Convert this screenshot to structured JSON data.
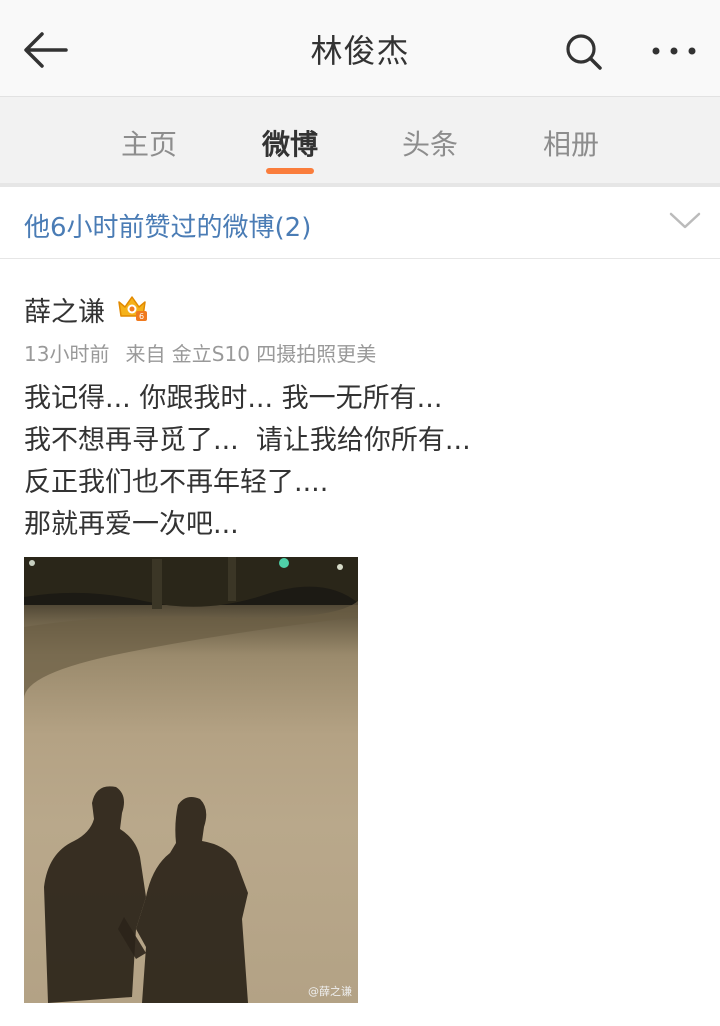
{
  "topbar": {
    "title": "林俊杰",
    "back_icon": "arrow-left-icon",
    "search_icon": "search-icon",
    "more_icon": "more-dots-icon"
  },
  "tabs": [
    {
      "label": "主页",
      "active": false
    },
    {
      "label": "微博",
      "active": true
    },
    {
      "label": "头条",
      "active": false
    },
    {
      "label": "相册",
      "active": false
    }
  ],
  "liked_section": {
    "label": "他6小时前赞过的微博(2)",
    "chevron_icon": "chevron-down-icon"
  },
  "post": {
    "author": "薛之谦",
    "badge_icon": "crown-vip-badge-icon",
    "time": "13小时前",
    "source": "来自 金立S10 四摄拍照更美",
    "lines": [
      "我记得... 你跟我时... 我一无所有...",
      "我不想再寻觅了...  请让我给你所有...",
      "反正我们也不再年轻了....",
      "那就再爱一次吧..."
    ],
    "image_watermark": "@薛之谦"
  },
  "colors": {
    "accent": "#fa7d3c",
    "link_blue": "#4a7cb5",
    "meta_gray": "#999999"
  }
}
